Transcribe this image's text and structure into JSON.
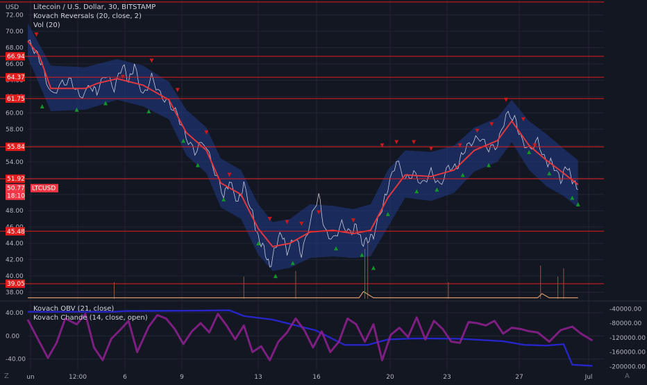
{
  "header": {
    "currency": "USD",
    "title": "Litecoin / U.S. Dollar, 30, BITSTAMP",
    "indicator_1": "Kovach Reversals (20, close, 2)",
    "indicator_2": "Vol (20)",
    "bottom_indicator_1": "Kovach OBV (21, close)",
    "bottom_indicator_2": "Kovach Chande (14, close, open)"
  },
  "corner": {
    "left": "Z",
    "right": "A"
  },
  "colors": {
    "background": "#131722",
    "grid": "#232632",
    "level_line": "#e11d1d",
    "trend": "#e0383e",
    "price": "#e8e8f0",
    "band": "#1f3a8a",
    "volume": "#d69a6a",
    "obv": "#2525c8",
    "chande": "#8a1f8c",
    "up_marker": "#149626",
    "down_marker": "#c81a1a"
  },
  "chart_data": [
    {
      "type": "line",
      "title": "Litecoin / U.S. Dollar, 30, BITSTAMP",
      "xlabel": "",
      "ylabel": "",
      "ylim": [
        37.4,
        73.8
      ],
      "x_ticks": [
        "un",
        "12:00",
        "6",
        "9",
        "13",
        "16",
        "20",
        "23",
        "27",
        "Jul"
      ],
      "y_ticks": [
        38.0,
        40.0,
        42.0,
        44.0,
        46.0,
        48.0,
        50.0,
        52.0,
        54.0,
        56.0,
        58.0,
        60.0,
        62.0,
        64.0,
        66.0,
        68.0,
        70.0,
        72.0
      ],
      "grid": true,
      "close_series": [
        [
          0,
          68.8
        ],
        [
          6,
          67.4
        ],
        [
          10,
          65.8
        ],
        [
          16,
          62.2
        ],
        [
          24,
          63.6
        ],
        [
          30,
          64.0
        ],
        [
          36,
          62.0
        ],
        [
          44,
          63.2
        ],
        [
          48,
          62.6
        ],
        [
          54,
          64.8
        ],
        [
          60,
          63.0
        ],
        [
          66,
          66.0
        ],
        [
          70,
          63.8
        ],
        [
          74,
          65.8
        ],
        [
          80,
          62.0
        ],
        [
          86,
          64.4
        ],
        [
          92,
          62.2
        ],
        [
          98,
          61.2
        ],
        [
          104,
          59.8
        ],
        [
          110,
          57.0
        ],
        [
          116,
          55.2
        ],
        [
          122,
          56.6
        ],
        [
          130,
          52.8
        ],
        [
          136,
          49.8
        ],
        [
          140,
          51.6
        ],
        [
          146,
          49.0
        ],
        [
          150,
          51.2
        ],
        [
          156,
          47.6
        ],
        [
          160,
          44.6
        ],
        [
          164,
          43.4
        ],
        [
          168,
          41.0
        ],
        [
          172,
          43.6
        ],
        [
          176,
          45.4
        ],
        [
          180,
          43.0
        ],
        [
          186,
          44.8
        ],
        [
          190,
          42.6
        ],
        [
          196,
          46.6
        ],
        [
          202,
          50.0
        ],
        [
          206,
          45.6
        ],
        [
          212,
          44.4
        ],
        [
          218,
          46.4
        ],
        [
          224,
          45.2
        ],
        [
          228,
          46.2
        ],
        [
          232,
          44.0
        ],
        [
          236,
          44.4
        ],
        [
          240,
          45.0
        ],
        [
          246,
          48.4
        ],
        [
          250,
          50.8
        ],
        [
          256,
          54.2
        ],
        [
          262,
          51.8
        ],
        [
          268,
          52.6
        ],
        [
          274,
          51.2
        ],
        [
          280,
          52.8
        ],
        [
          286,
          51.0
        ],
        [
          292,
          53.4
        ],
        [
          298,
          53.2
        ],
        [
          302,
          55.2
        ],
        [
          308,
          56.4
        ],
        [
          314,
          57.0
        ],
        [
          320,
          55.6
        ],
        [
          326,
          56.0
        ],
        [
          332,
          59.8
        ],
        [
          338,
          59.4
        ],
        [
          342,
          57.0
        ],
        [
          348,
          55.4
        ],
        [
          354,
          56.6
        ],
        [
          360,
          53.8
        ],
        [
          364,
          54.0
        ],
        [
          370,
          51.6
        ],
        [
          374,
          53.6
        ],
        [
          378,
          51.8
        ],
        [
          382,
          50.6
        ]
      ],
      "trend_series": [
        [
          0,
          68.8
        ],
        [
          8,
          67.0
        ],
        [
          16,
          63.0
        ],
        [
          40,
          63.0
        ],
        [
          48,
          63.6
        ],
        [
          62,
          64.2
        ],
        [
          80,
          63.4
        ],
        [
          98,
          61.6
        ],
        [
          110,
          57.6
        ],
        [
          124,
          55.4
        ],
        [
          134,
          51.4
        ],
        [
          148,
          50.0
        ],
        [
          160,
          45.8
        ],
        [
          170,
          43.6
        ],
        [
          182,
          44.0
        ],
        [
          196,
          45.4
        ],
        [
          212,
          45.6
        ],
        [
          226,
          45.2
        ],
        [
          238,
          45.6
        ],
        [
          250,
          49.6
        ],
        [
          262,
          52.4
        ],
        [
          280,
          52.2
        ],
        [
          296,
          53.0
        ],
        [
          310,
          55.4
        ],
        [
          326,
          56.6
        ],
        [
          336,
          59.0
        ],
        [
          348,
          56.0
        ],
        [
          360,
          54.2
        ],
        [
          372,
          52.6
        ],
        [
          382,
          51.2
        ]
      ],
      "band": [
        [
          0,
          71.0,
          66.8
        ],
        [
          16,
          65.8,
          60.2
        ],
        [
          40,
          65.6,
          60.4
        ],
        [
          62,
          66.6,
          61.6
        ],
        [
          80,
          65.8,
          60.8
        ],
        [
          98,
          63.8,
          59.2
        ],
        [
          110,
          60.4,
          54.8
        ],
        [
          124,
          58.2,
          52.6
        ],
        [
          134,
          54.4,
          48.4
        ],
        [
          148,
          53.0,
          47.0
        ],
        [
          160,
          48.8,
          42.6
        ],
        [
          170,
          46.6,
          40.6
        ],
        [
          182,
          47.0,
          41.0
        ],
        [
          196,
          48.8,
          42.2
        ],
        [
          212,
          48.6,
          42.4
        ],
        [
          226,
          48.2,
          42.2
        ],
        [
          238,
          48.8,
          42.4
        ],
        [
          250,
          53.0,
          46.0
        ],
        [
          262,
          55.4,
          49.6
        ],
        [
          280,
          55.2,
          49.2
        ],
        [
          296,
          56.0,
          50.2
        ],
        [
          310,
          58.2,
          52.8
        ],
        [
          326,
          59.4,
          54.0
        ],
        [
          336,
          61.6,
          56.4
        ],
        [
          348,
          59.0,
          53.0
        ],
        [
          360,
          57.4,
          51.0
        ],
        [
          372,
          55.6,
          49.8
        ],
        [
          382,
          54.2,
          48.4
        ]
      ],
      "horizontal_levels": [
        {
          "label": "",
          "value": 73.6
        },
        {
          "label": "66.94",
          "value": 66.94
        },
        {
          "label": "64.37",
          "value": 64.37
        },
        {
          "label": "61.75",
          "value": 61.75
        },
        {
          "label": "55.84",
          "value": 55.84
        },
        {
          "label": "51.92",
          "value": 51.92
        },
        {
          "label": "45.48",
          "value": 45.48
        },
        {
          "label": "39.05",
          "value": 39.05
        }
      ],
      "up_markers": [
        [
          10,
          60.8
        ],
        [
          34,
          60.4
        ],
        [
          54,
          61.2
        ],
        [
          84,
          60.2
        ],
        [
          108,
          56.6
        ],
        [
          118,
          53.6
        ],
        [
          136,
          49.4
        ],
        [
          160,
          44.0
        ],
        [
          172,
          40.0
        ],
        [
          184,
          41.6
        ],
        [
          214,
          43.4
        ],
        [
          232,
          42.6
        ],
        [
          240,
          41.0
        ],
        [
          250,
          47.6
        ],
        [
          270,
          50.4
        ],
        [
          284,
          50.6
        ],
        [
          302,
          52.4
        ],
        [
          320,
          53.6
        ],
        [
          348,
          55.2
        ],
        [
          362,
          52.6
        ],
        [
          378,
          49.6
        ],
        [
          382,
          48.8
        ]
      ],
      "down_markers": [
        [
          6,
          69.6
        ],
        [
          66,
          64.4
        ],
        [
          86,
          66.4
        ],
        [
          104,
          62.8
        ],
        [
          124,
          57.6
        ],
        [
          140,
          52.4
        ],
        [
          168,
          47.0
        ],
        [
          180,
          46.6
        ],
        [
          190,
          46.4
        ],
        [
          202,
          47.8
        ],
        [
          226,
          46.8
        ],
        [
          246,
          56.0
        ],
        [
          256,
          56.4
        ],
        [
          268,
          56.4
        ],
        [
          280,
          55.6
        ],
        [
          300,
          56.0
        ],
        [
          312,
          57.8
        ],
        [
          322,
          58.6
        ],
        [
          332,
          61.6
        ],
        [
          344,
          59.2
        ],
        [
          352,
          56.0
        ]
      ],
      "last_price": {
        "value": 50.77,
        "symbol": "LTCUSD",
        "countdown": "18:10"
      }
    },
    {
      "type": "bar",
      "title": "Vol (20)",
      "description": "volume bars near bottom of price pane",
      "spikes": [
        [
          60,
          0.3
        ],
        [
          150,
          0.4
        ],
        [
          186,
          0.5
        ],
        [
          234,
          0.9
        ],
        [
          236,
          1.0
        ],
        [
          292,
          0.3
        ],
        [
          356,
          0.6
        ],
        [
          368,
          0.4
        ],
        [
          372,
          0.55
        ]
      ],
      "ma_series": [
        [
          0,
          0.05
        ],
        [
          230,
          0.05
        ],
        [
          233,
          0.35
        ],
        [
          240,
          0.05
        ],
        [
          354,
          0.05
        ],
        [
          357,
          0.25
        ],
        [
          362,
          0.05
        ],
        [
          382,
          0.05
        ]
      ]
    },
    {
      "type": "line",
      "title": "Kovach OBV (21, close)",
      "ylim": [
        -205000,
        -20000
      ],
      "y_ticks": [
        -40000.0,
        -80000.0,
        -120000.0,
        -160000.0,
        -200000.0
      ],
      "series": [
        [
          0,
          -48000
        ],
        [
          60,
          -48000
        ],
        [
          68,
          -46000
        ],
        [
          120,
          -45000
        ],
        [
          140,
          -44000
        ],
        [
          150,
          -60000
        ],
        [
          170,
          -70000
        ],
        [
          190,
          -90000
        ],
        [
          200,
          -100000
        ],
        [
          210,
          -120000
        ],
        [
          220,
          -140000
        ],
        [
          236,
          -140000
        ],
        [
          250,
          -125000
        ],
        [
          270,
          -122000
        ],
        [
          300,
          -123000
        ],
        [
          330,
          -130000
        ],
        [
          345,
          -140000
        ],
        [
          360,
          -142000
        ],
        [
          372,
          -138000
        ],
        [
          378,
          -195000
        ],
        [
          392,
          -198000
        ]
      ]
    },
    {
      "type": "line",
      "title": "Kovach Chande (14, close, open)",
      "ylim": [
        -56,
        52
      ],
      "y_ticks": [
        40.0,
        0.0,
        -40.0
      ],
      "series": [
        [
          0,
          28
        ],
        [
          8,
          -10
        ],
        [
          14,
          -38
        ],
        [
          20,
          -12
        ],
        [
          26,
          30
        ],
        [
          34,
          20
        ],
        [
          40,
          38
        ],
        [
          46,
          -20
        ],
        [
          52,
          -42
        ],
        [
          58,
          -5
        ],
        [
          64,
          10
        ],
        [
          70,
          26
        ],
        [
          76,
          -28
        ],
        [
          84,
          16
        ],
        [
          90,
          36
        ],
        [
          96,
          30
        ],
        [
          102,
          12
        ],
        [
          108,
          -14
        ],
        [
          114,
          8
        ],
        [
          120,
          22
        ],
        [
          126,
          6
        ],
        [
          132,
          38
        ],
        [
          138,
          18
        ],
        [
          144,
          -6
        ],
        [
          150,
          18
        ],
        [
          156,
          -28
        ],
        [
          162,
          -18
        ],
        [
          168,
          -42
        ],
        [
          174,
          -10
        ],
        [
          180,
          6
        ],
        [
          186,
          30
        ],
        [
          192,
          10
        ],
        [
          198,
          -20
        ],
        [
          204,
          8
        ],
        [
          210,
          -28
        ],
        [
          216,
          -10
        ],
        [
          222,
          30
        ],
        [
          228,
          20
        ],
        [
          234,
          -10
        ],
        [
          240,
          20
        ],
        [
          246,
          -42
        ],
        [
          252,
          2
        ],
        [
          258,
          14
        ],
        [
          264,
          -2
        ],
        [
          270,
          32
        ],
        [
          276,
          -6
        ],
        [
          282,
          26
        ],
        [
          288,
          12
        ],
        [
          294,
          -10
        ],
        [
          300,
          -12
        ],
        [
          306,
          24
        ],
        [
          312,
          22
        ],
        [
          318,
          18
        ],
        [
          324,
          26
        ],
        [
          330,
          4
        ],
        [
          336,
          14
        ],
        [
          342,
          12
        ],
        [
          348,
          8
        ],
        [
          354,
          6
        ],
        [
          362,
          -10
        ],
        [
          370,
          10
        ],
        [
          378,
          16
        ],
        [
          384,
          4
        ],
        [
          392,
          -8
        ]
      ]
    }
  ]
}
